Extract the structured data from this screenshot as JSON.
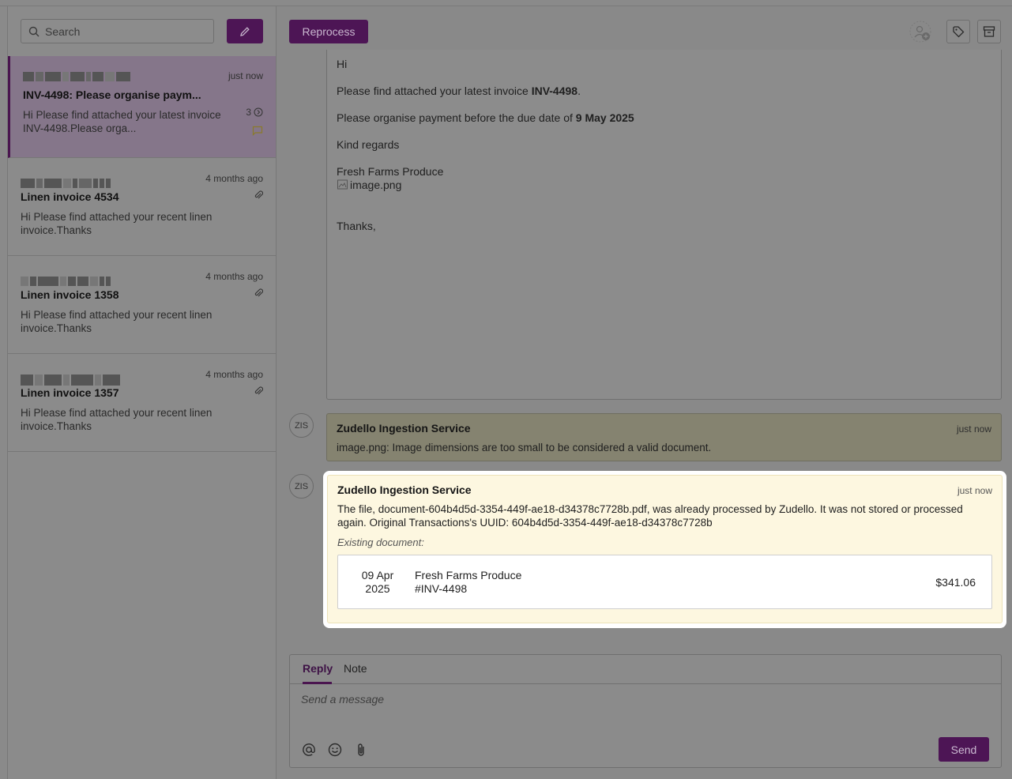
{
  "search": {
    "placeholder": "Search"
  },
  "conversations": [
    {
      "time": "just now",
      "subject": "INV-4498: Please organise paym...",
      "preview": "Hi Please find attached your latest invoice INV-4498.Please orga...",
      "count": "3"
    },
    {
      "time": "4 months ago",
      "subject": "Linen invoice 4534",
      "preview": "Hi Please find attached your recent linen invoice.Thanks"
    },
    {
      "time": "4 months ago",
      "subject": "Linen invoice 1358",
      "preview": "Hi Please find attached your recent linen invoice.Thanks"
    },
    {
      "time": "4 months ago",
      "subject": "Linen invoice 1357",
      "preview": "Hi Please find attached your recent linen invoice.Thanks"
    }
  ],
  "toolbar": {
    "reprocess_label": "Reprocess"
  },
  "email": {
    "greeting": "Hi",
    "line1_pre": "Please find attached your latest invoice ",
    "line1_bold": "INV-4498",
    "line1_post": ".",
    "line2_pre": "Please organise payment before the due date of ",
    "line2_bold": "9 May 2025",
    "sign_off": "Kind regards",
    "company": "Fresh Farms Produce",
    "image_alt": "image.png",
    "thanks": "Thanks,"
  },
  "messages": [
    {
      "avatar": "ZIS",
      "sender": "Zudello Ingestion Service",
      "time": "just now",
      "text": "image.png: Image dimensions are too small to be considered a valid document."
    },
    {
      "avatar": "ZIS",
      "sender": "Zudello Ingestion Service",
      "time": "just now",
      "text": "The file, document-604b4d5d-3354-449f-ae18-d34378c7728b.pdf, was already processed by Zudello. It was not stored or processed again. Original Transactions's UUID: 604b4d5d-3354-449f-ae18-d34378c7728b",
      "existing_label": "Existing document:",
      "document": {
        "date_line1": "09 Apr",
        "date_line2": "2025",
        "vendor": "Fresh Farms Produce",
        "number": "#INV-4498",
        "amount": "$341.06"
      }
    }
  ],
  "composer": {
    "tab_reply": "Reply",
    "tab_note": "Note",
    "placeholder": "Send a message",
    "send_label": "Send"
  },
  "colors": {
    "brand": "#4d1555",
    "highlight_bg": "#fdf7e0"
  }
}
